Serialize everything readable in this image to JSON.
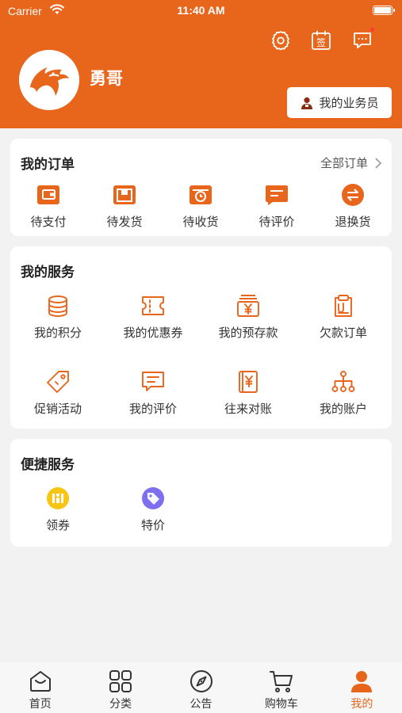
{
  "status_bar": {
    "carrier": "Carrier",
    "time": "11:40 AM"
  },
  "header": {
    "username": "勇哥",
    "salesman_button": "我的业务员",
    "icons": [
      "gear-icon",
      "sign-in-calendar-icon",
      "message-icon"
    ],
    "sign_in_glyph": "签"
  },
  "orders": {
    "title": "我的订单",
    "view_all": "全部订单",
    "items": [
      {
        "label": "待支付",
        "icon": "wallet-icon"
      },
      {
        "label": "待发货",
        "icon": "box-icon"
      },
      {
        "label": "待收货",
        "icon": "delivery-clock-icon"
      },
      {
        "label": "待评价",
        "icon": "comment-icon"
      },
      {
        "label": "退换货",
        "icon": "exchange-icon"
      }
    ]
  },
  "services": {
    "title": "我的服务",
    "items": [
      {
        "label": "我的积分",
        "icon": "coins-icon"
      },
      {
        "label": "我的优惠券",
        "icon": "coupon-icon"
      },
      {
        "label": "我的预存款",
        "icon": "yen-deposit-icon"
      },
      {
        "label": "欠款订单",
        "icon": "clipboard-icon"
      },
      {
        "label": "促销活动",
        "icon": "tag-icon"
      },
      {
        "label": "我的评价",
        "icon": "review-icon"
      },
      {
        "label": "往来对账",
        "icon": "ledger-icon"
      },
      {
        "label": "我的账户",
        "icon": "account-tree-icon"
      }
    ]
  },
  "quick": {
    "title": "便捷服务",
    "items": [
      {
        "label": "领券",
        "icon": "get-coupon-icon",
        "color": "#f7c514"
      },
      {
        "label": "特价",
        "icon": "special-price-icon",
        "color": "#7d6ff0"
      }
    ]
  },
  "tabbar": {
    "items": [
      {
        "label": "首页",
        "icon": "home-icon"
      },
      {
        "label": "分类",
        "icon": "category-grid-icon"
      },
      {
        "label": "公告",
        "icon": "compass-icon"
      },
      {
        "label": "购物车",
        "icon": "cart-icon"
      },
      {
        "label": "我的",
        "icon": "user-icon",
        "active": true
      }
    ]
  },
  "colors": {
    "brand": "#e8651c",
    "background": "#f2f2f2",
    "card": "#ffffff"
  }
}
